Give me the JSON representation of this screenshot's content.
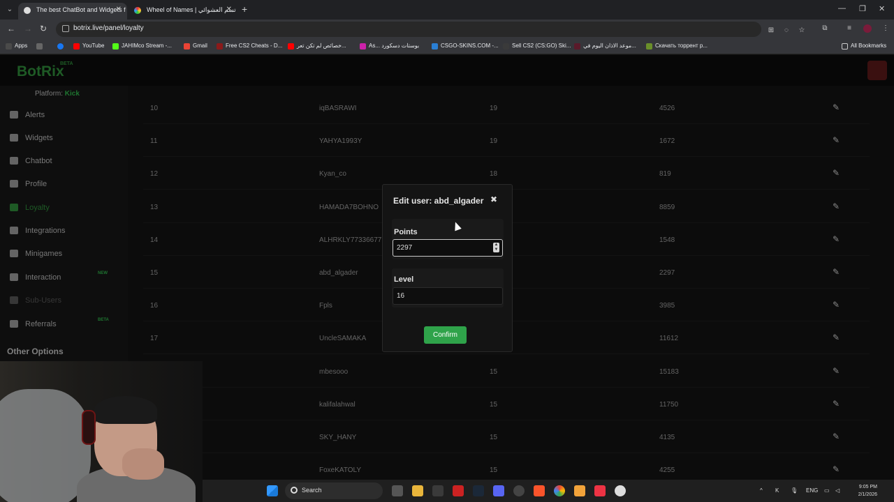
{
  "browser": {
    "tabs": [
      {
        "label": "The best ChatBot and Widgets f",
        "active": true
      },
      {
        "label": "Wheel of Names | تسم العشوائي",
        "active": false
      }
    ],
    "url": "botrix.live/panel/loyalty",
    "bookmarks": [
      "Apps",
      "YouTube",
      "JAHIMco Stream -...",
      "Gmail",
      "Free CS2 Cheats - D...",
      "خصائص لم تكن تعر...",
      "As... بوستات دسكورد",
      "CSGO-SKINS.COM -...",
      "Sell CS2 (CS:GO) Ski...",
      "موعد الاذان اليوم في...",
      "Скачать торрент p...",
      "All Bookmarks"
    ]
  },
  "app": {
    "logo": "BotRix",
    "beta": "BETA",
    "platform_label": "Platform:",
    "platform_value": "Kick"
  },
  "sidebar": {
    "items": [
      {
        "label": "Alerts",
        "icon": "warning-icon"
      },
      {
        "label": "Widgets",
        "icon": "grid-icon"
      },
      {
        "label": "Chatbot",
        "icon": "robot-icon"
      },
      {
        "label": "Profile",
        "icon": "profile-card-icon"
      },
      {
        "label": "Loyalty",
        "icon": "trophy-icon",
        "active": true
      },
      {
        "label": "Integrations",
        "icon": "puzzle-icon"
      },
      {
        "label": "Minigames",
        "icon": "gamepad-icon"
      },
      {
        "label": "Interaction",
        "icon": "music-note-icon",
        "tag": "NEW"
      },
      {
        "label": "Sub-Users",
        "icon": "users-icon",
        "disabled": true
      },
      {
        "label": "Referrals",
        "icon": "user-group-icon",
        "tag": "BETA"
      }
    ],
    "other_options": "Other Options"
  },
  "table": {
    "rows": [
      {
        "rank": "10",
        "user": "iqBASRAWI",
        "level": "19",
        "points": "4526"
      },
      {
        "rank": "11",
        "user": "YAHYA1993Y",
        "level": "19",
        "points": "1672"
      },
      {
        "rank": "12",
        "user": "Kyan_co",
        "level": "18",
        "points": "819"
      },
      {
        "rank": "13",
        "user": "HAMADA7BOHNO",
        "level": "",
        "points": "8859"
      },
      {
        "rank": "14",
        "user": "ALHRKLY77336677",
        "level": "",
        "points": "1548"
      },
      {
        "rank": "15",
        "user": "abd_algader",
        "level": "",
        "points": "2297"
      },
      {
        "rank": "16",
        "user": "Fpls",
        "level": "",
        "points": "3985"
      },
      {
        "rank": "17",
        "user": "UncleSAMAKA",
        "level": "",
        "points": "11612"
      },
      {
        "rank": "",
        "user": "mbesooo",
        "level": "15",
        "points": "15183"
      },
      {
        "rank": "",
        "user": "kalifalahwal",
        "level": "15",
        "points": "11750"
      },
      {
        "rank": "",
        "user": "SKY_HANY",
        "level": "15",
        "points": "4135"
      },
      {
        "rank": "",
        "user": "FoxeKATOLY",
        "level": "15",
        "points": "4255"
      }
    ]
  },
  "modal": {
    "title": "Edit user: abd_algader",
    "points_label": "Points",
    "points_value": "2297",
    "level_label": "Level",
    "level_value": "16",
    "confirm_label": "Confirm"
  },
  "taskbar": {
    "search_label": "Search",
    "lang": "ENG",
    "time": "9:05 PM",
    "date": "2/1/2026"
  }
}
